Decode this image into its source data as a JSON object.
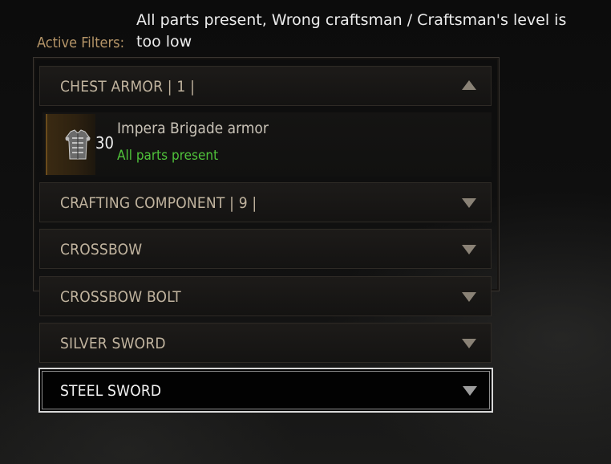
{
  "tooltip": {
    "text": "All parts present, Wrong craftsman / Craftsman's level is too low"
  },
  "filters": {
    "label": "Active Filters:"
  },
  "categories": [
    {
      "label": "CHEST ARMOR | 1 |",
      "expanded": true
    },
    {
      "label": "CRAFTING COMPONENT | 9 |",
      "expanded": false
    },
    {
      "label": "CROSSBOW",
      "expanded": false
    },
    {
      "label": "CROSSBOW BOLT",
      "expanded": false
    },
    {
      "label": "SILVER SWORD",
      "expanded": false
    },
    {
      "label": "STEEL SWORD",
      "expanded": false,
      "selected": true
    }
  ],
  "item": {
    "icon": "chest-armor-icon",
    "count": "30",
    "name": "Impera Brigade armor",
    "status": "All parts present"
  },
  "colors": {
    "status_green": "#4fc23a",
    "label_gold": "#b59568",
    "selection_border": "#d8d8d8"
  }
}
